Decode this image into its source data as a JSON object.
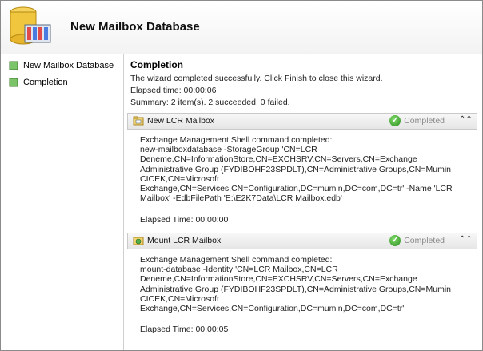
{
  "header": {
    "title": "New Mailbox Database"
  },
  "sidebar": {
    "items": [
      {
        "label": "New Mailbox Database"
      },
      {
        "label": "Completion"
      }
    ]
  },
  "main": {
    "section_title": "Completion",
    "message": "The wizard completed successfully. Click Finish to close this wizard.",
    "elapsed": "Elapsed time: 00:00:06",
    "summary": "Summary: 2 item(s). 2 succeeded, 0 failed.",
    "panels": [
      {
        "title": "New LCR Mailbox",
        "status": "Completed",
        "body": "Exchange Management Shell command completed:\nnew-mailboxdatabase -StorageGroup 'CN=LCR\nDeneme,CN=InformationStore,CN=EXCHSRV,CN=Servers,CN=Exchange\nAdministrative Group (FYDIBOHF23SPDLT),CN=Administrative Groups,CN=Mumin\nCICEK,CN=Microsoft\nExchange,CN=Services,CN=Configuration,DC=mumin,DC=com,DC=tr' -Name 'LCR\nMailbox' -EdbFilePath 'E:\\E2K7Data\\LCR Mailbox.edb'",
        "elapsed": "Elapsed Time: 00:00:00"
      },
      {
        "title": "Mount LCR Mailbox",
        "status": "Completed",
        "body": "Exchange Management Shell command completed:\nmount-database -Identity 'CN=LCR Mailbox,CN=LCR\nDeneme,CN=InformationStore,CN=EXCHSRV,CN=Servers,CN=Exchange\nAdministrative Group (FYDIBOHF23SPDLT),CN=Administrative Groups,CN=Mumin\nCICEK,CN=Microsoft\nExchange,CN=Services,CN=Configuration,DC=mumin,DC=com,DC=tr'",
        "elapsed": "Elapsed Time: 00:00:05"
      }
    ]
  },
  "icons": {
    "header": "mailbox-database-icon",
    "nav": "step-icon",
    "panel1": "mailbox-folder-icon",
    "panel2": "mount-mailbox-icon",
    "status": "checkmark-icon",
    "collapse": "chevron-double-up-icon"
  },
  "colors": {
    "accent": "#2d8a1f",
    "status_text": "#8a8a8a"
  }
}
